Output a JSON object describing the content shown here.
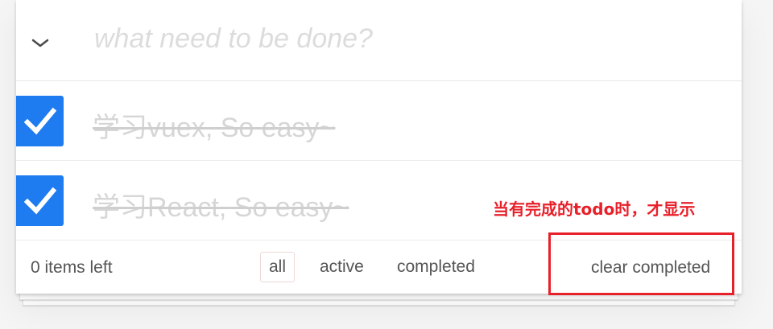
{
  "header": {
    "new_todo_placeholder": "what need to be done?"
  },
  "todos": [
    {
      "label": "学习vuex, So easy~",
      "completed": true
    },
    {
      "label": "学习React, So easy~",
      "completed": true
    }
  ],
  "footer": {
    "items_left": "0 items left",
    "filters": [
      "all",
      "active",
      "completed"
    ],
    "selected_filter": "all",
    "clear_completed": "clear completed"
  },
  "annotation": {
    "text": "当有完成的todo时，才显示",
    "color": "#e8202a"
  },
  "colors": {
    "checkbox": "#1e7bf0",
    "completed_text": "#d6d6d6"
  }
}
